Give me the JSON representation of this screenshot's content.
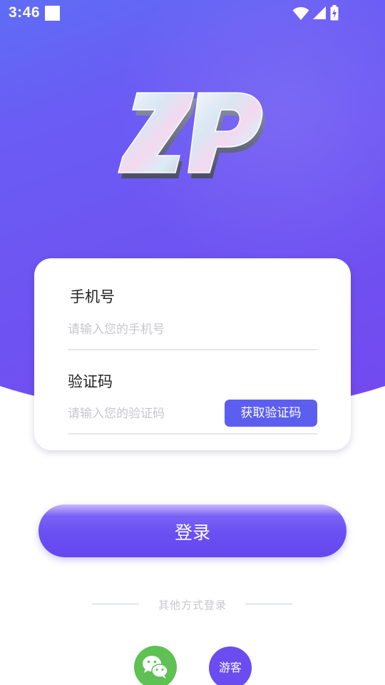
{
  "status_bar": {
    "time": "3:46"
  },
  "theme": {
    "gradient_start": "#4e86f7",
    "gradient_end": "#7447ef",
    "accent": "#6a4cf0",
    "wechat_green": "#5fc154"
  },
  "logo": {
    "icon": "zp-logo-icon"
  },
  "form": {
    "phone": {
      "label": "手机号",
      "value": "",
      "placeholder": "请输入您的手机号"
    },
    "code": {
      "label": "验证码",
      "value": "",
      "placeholder": "请输入您的验证码",
      "get_code_label": "获取验证码"
    }
  },
  "login_button": {
    "label": "登录"
  },
  "other_login": {
    "title": "其他方式登录",
    "wechat_icon": "wechat-icon",
    "guest_label": "游客"
  }
}
